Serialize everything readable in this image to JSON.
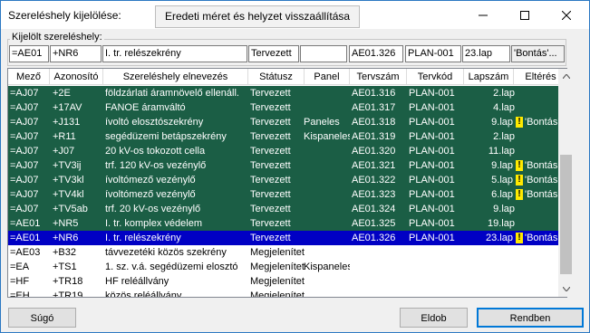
{
  "window": {
    "title": "Szereléshely kijelölése:",
    "restore_label": "Eredeti méret és helyzet visszaállítása"
  },
  "selected": {
    "group_label": "Kijelölt szereléshely:",
    "fields": [
      "=AE01",
      "+NR6",
      "I. tr. relészekrény",
      "Tervezett",
      "",
      "AE01.326",
      "PLAN-001",
      "23.lap",
      "'Bontás'..."
    ]
  },
  "columns": [
    "Mező",
    "Azonosító",
    "Szereléshely elnevezés",
    "Státusz",
    "Panel",
    "Tervszám",
    "Tervkód",
    "Lapszám",
    "Eltérés"
  ],
  "rows": [
    {
      "mezo": "=AJ07",
      "azon": "+2E",
      "nev": "földzárlati áramnövelő ellenáll.",
      "statusz": "Tervezett",
      "panel": "",
      "tervszam": "AE01.316",
      "tervkod": "PLAN-001",
      "lap": "2.lap",
      "warn": false,
      "elteres": "",
      "style": "green"
    },
    {
      "mezo": "=AJ07",
      "azon": "+17AV",
      "nev": "FANOE áramváltó",
      "statusz": "Tervezett",
      "panel": "",
      "tervszam": "AE01.317",
      "tervkod": "PLAN-001",
      "lap": "4.lap",
      "warn": false,
      "elteres": "",
      "style": "green"
    },
    {
      "mezo": "=AJ07",
      "azon": "+J131",
      "nev": "ívoltó elosztószekrény",
      "statusz": "Tervezett",
      "panel": "Paneles",
      "tervszam": "AE01.318",
      "tervkod": "PLAN-001",
      "lap": "9.lap",
      "warn": true,
      "elteres": "'Bontás'...",
      "style": "green"
    },
    {
      "mezo": "=AJ07",
      "azon": "+R11",
      "nev": "segédüzemi betápszekrény",
      "statusz": "Tervezett",
      "panel": "Kispaneles",
      "tervszam": "AE01.319",
      "tervkod": "PLAN-001",
      "lap": "2.lap",
      "warn": false,
      "elteres": "",
      "style": "green"
    },
    {
      "mezo": "=AJ07",
      "azon": "+J07",
      "nev": "20 kV-os tokozott cella",
      "statusz": "Tervezett",
      "panel": "",
      "tervszam": "AE01.320",
      "tervkod": "PLAN-001",
      "lap": "11.lap",
      "warn": false,
      "elteres": "",
      "style": "green"
    },
    {
      "mezo": "=AJ07",
      "azon": "+TV3ij",
      "nev": "trf. 120 kV-os vezénylő",
      "statusz": "Tervezett",
      "panel": "",
      "tervszam": "AE01.321",
      "tervkod": "PLAN-001",
      "lap": "9.lap",
      "warn": true,
      "elteres": "'Bontás'...",
      "style": "green"
    },
    {
      "mezo": "=AJ07",
      "azon": "+TV3kl",
      "nev": "ívoltómező vezénylő",
      "statusz": "Tervezett",
      "panel": "",
      "tervszam": "AE01.322",
      "tervkod": "PLAN-001",
      "lap": "5.lap",
      "warn": true,
      "elteres": "'Bontás'...",
      "style": "green"
    },
    {
      "mezo": "=AJ07",
      "azon": "+TV4kl",
      "nev": "ívoltómező vezénylő",
      "statusz": "Tervezett",
      "panel": "",
      "tervszam": "AE01.323",
      "tervkod": "PLAN-001",
      "lap": "6.lap",
      "warn": true,
      "elteres": "'Bontás'...",
      "style": "green"
    },
    {
      "mezo": "=AJ07",
      "azon": "+TV5ab",
      "nev": "trf. 20 kV-os vezénylő",
      "statusz": "Tervezett",
      "panel": "",
      "tervszam": "AE01.324",
      "tervkod": "PLAN-001",
      "lap": "9.lap",
      "warn": false,
      "elteres": "",
      "style": "green"
    },
    {
      "mezo": "=AE01",
      "azon": "+NR5",
      "nev": "I. tr. komplex védelem",
      "statusz": "Tervezett",
      "panel": "",
      "tervszam": "AE01.325",
      "tervkod": "PLAN-001",
      "lap": "19.lap",
      "warn": false,
      "elteres": "",
      "style": "green"
    },
    {
      "mezo": "=AE01",
      "azon": "+NR6",
      "nev": "I. tr. relészekrény",
      "statusz": "Tervezett",
      "panel": "",
      "tervszam": "AE01.326",
      "tervkod": "PLAN-001",
      "lap": "23.lap",
      "warn": true,
      "elteres": "'Bontás'...",
      "style": "selected"
    },
    {
      "mezo": "=AE03",
      "azon": "+B32",
      "nev": "távvezetéki közös szekrény",
      "statusz": "Megjelenített",
      "panel": "",
      "tervszam": "",
      "tervkod": "",
      "lap": "",
      "warn": false,
      "elteres": "",
      "style": "white"
    },
    {
      "mezo": "=EA",
      "azon": "+TS1",
      "nev": "1. sz. v.á. segédüzemi elosztó",
      "statusz": "Megjelenített",
      "panel": "Kispaneles",
      "tervszam": "",
      "tervkod": "",
      "lap": "",
      "warn": false,
      "elteres": "",
      "style": "white"
    },
    {
      "mezo": "=HF",
      "azon": "+TR18",
      "nev": "HF reléállvány",
      "statusz": "Megjelenített",
      "panel": "",
      "tervszam": "",
      "tervkod": "",
      "lap": "",
      "warn": false,
      "elteres": "",
      "style": "white"
    },
    {
      "mezo": "=EH",
      "azon": "+TR19",
      "nev": "közös reléállvány",
      "statusz": "Megjelenített",
      "panel": "",
      "tervszam": "",
      "tervkod": "",
      "lap": "",
      "warn": false,
      "elteres": "",
      "style": "white"
    }
  ],
  "buttons": {
    "help": "Súgó",
    "discard": "Eldob",
    "ok": "Rendben"
  },
  "colors": {
    "green_row": "#1b5e45",
    "selected_row": "#0000c4",
    "warning": "#ffea00"
  },
  "icons": [
    "minimize-icon",
    "maximize-icon",
    "close-icon",
    "scroll-up-arrow-icon",
    "scroll-down-arrow-icon",
    "warning-icon"
  ]
}
